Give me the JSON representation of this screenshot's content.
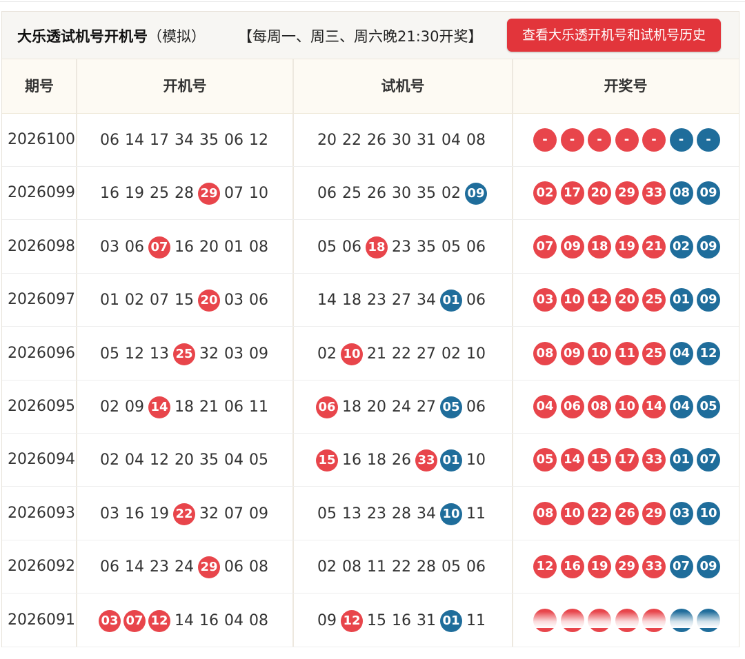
{
  "header": {
    "title": "大乐透试机号开机号",
    "title_suffix": "（模拟）",
    "schedule": "【每周一、周三、周六晚21:30开奖】",
    "history_button": "查看大乐透开机号和试机号历史"
  },
  "columns": [
    "期号",
    "开机号",
    "试机号",
    "开奖号"
  ],
  "colors": {
    "red": "#e8454b",
    "blue": "#1f6d9b",
    "button": "#e2353b"
  },
  "rows": [
    {
      "period": "2026100",
      "kaiji": [
        {
          "v": "06"
        },
        {
          "v": "14"
        },
        {
          "v": "17"
        },
        {
          "v": "34"
        },
        {
          "v": "35"
        },
        {
          "v": "06"
        },
        {
          "v": "12"
        }
      ],
      "shiji": [
        {
          "v": "20"
        },
        {
          "v": "22"
        },
        {
          "v": "26"
        },
        {
          "v": "30"
        },
        {
          "v": "31"
        },
        {
          "v": "04"
        },
        {
          "v": "08"
        }
      ],
      "winning": [
        "-",
        "-",
        "-",
        "-",
        "-",
        "-",
        "-"
      ]
    },
    {
      "period": "2026099",
      "kaiji": [
        {
          "v": "16"
        },
        {
          "v": "19"
        },
        {
          "v": "25"
        },
        {
          "v": "28"
        },
        {
          "v": "29",
          "c": "red"
        },
        {
          "v": "07"
        },
        {
          "v": "10"
        }
      ],
      "shiji": [
        {
          "v": "06"
        },
        {
          "v": "25"
        },
        {
          "v": "26"
        },
        {
          "v": "30"
        },
        {
          "v": "35"
        },
        {
          "v": "02"
        },
        {
          "v": "09",
          "c": "blue"
        }
      ],
      "winning": [
        "02",
        "17",
        "20",
        "29",
        "33",
        "08",
        "09"
      ]
    },
    {
      "period": "2026098",
      "kaiji": [
        {
          "v": "03"
        },
        {
          "v": "06"
        },
        {
          "v": "07",
          "c": "red"
        },
        {
          "v": "16"
        },
        {
          "v": "20"
        },
        {
          "v": "01"
        },
        {
          "v": "08"
        }
      ],
      "shiji": [
        {
          "v": "05"
        },
        {
          "v": "06"
        },
        {
          "v": "18",
          "c": "red"
        },
        {
          "v": "23"
        },
        {
          "v": "35"
        },
        {
          "v": "05"
        },
        {
          "v": "06"
        }
      ],
      "winning": [
        "07",
        "09",
        "18",
        "19",
        "21",
        "02",
        "09"
      ]
    },
    {
      "period": "2026097",
      "kaiji": [
        {
          "v": "01"
        },
        {
          "v": "02"
        },
        {
          "v": "07"
        },
        {
          "v": "15"
        },
        {
          "v": "20",
          "c": "red"
        },
        {
          "v": "03"
        },
        {
          "v": "06"
        }
      ],
      "shiji": [
        {
          "v": "14"
        },
        {
          "v": "18"
        },
        {
          "v": "23"
        },
        {
          "v": "27"
        },
        {
          "v": "34"
        },
        {
          "v": "01",
          "c": "blue"
        },
        {
          "v": "06"
        }
      ],
      "winning": [
        "03",
        "10",
        "12",
        "20",
        "25",
        "01",
        "09"
      ]
    },
    {
      "period": "2026096",
      "kaiji": [
        {
          "v": "05"
        },
        {
          "v": "12"
        },
        {
          "v": "13"
        },
        {
          "v": "25",
          "c": "red"
        },
        {
          "v": "32"
        },
        {
          "v": "03"
        },
        {
          "v": "09"
        }
      ],
      "shiji": [
        {
          "v": "02"
        },
        {
          "v": "10",
          "c": "red"
        },
        {
          "v": "21"
        },
        {
          "v": "22"
        },
        {
          "v": "27"
        },
        {
          "v": "02"
        },
        {
          "v": "10"
        }
      ],
      "winning": [
        "08",
        "09",
        "10",
        "11",
        "25",
        "04",
        "12"
      ]
    },
    {
      "period": "2026095",
      "kaiji": [
        {
          "v": "02"
        },
        {
          "v": "09"
        },
        {
          "v": "14",
          "c": "red"
        },
        {
          "v": "18"
        },
        {
          "v": "21"
        },
        {
          "v": "06"
        },
        {
          "v": "11"
        }
      ],
      "shiji": [
        {
          "v": "06",
          "c": "red"
        },
        {
          "v": "18"
        },
        {
          "v": "20"
        },
        {
          "v": "24"
        },
        {
          "v": "27"
        },
        {
          "v": "05",
          "c": "blue"
        },
        {
          "v": "06"
        }
      ],
      "winning": [
        "04",
        "06",
        "08",
        "10",
        "14",
        "04",
        "05"
      ]
    },
    {
      "period": "2026094",
      "kaiji": [
        {
          "v": "02"
        },
        {
          "v": "04"
        },
        {
          "v": "12"
        },
        {
          "v": "20"
        },
        {
          "v": "35"
        },
        {
          "v": "04"
        },
        {
          "v": "05"
        }
      ],
      "shiji": [
        {
          "v": "15",
          "c": "red"
        },
        {
          "v": "16"
        },
        {
          "v": "18"
        },
        {
          "v": "26"
        },
        {
          "v": "33",
          "c": "red"
        },
        {
          "v": "01",
          "c": "blue"
        },
        {
          "v": "10"
        }
      ],
      "winning": [
        "05",
        "14",
        "15",
        "17",
        "33",
        "01",
        "07"
      ]
    },
    {
      "period": "2026093",
      "kaiji": [
        {
          "v": "03"
        },
        {
          "v": "16"
        },
        {
          "v": "19"
        },
        {
          "v": "22",
          "c": "red"
        },
        {
          "v": "32"
        },
        {
          "v": "07"
        },
        {
          "v": "09"
        }
      ],
      "shiji": [
        {
          "v": "05"
        },
        {
          "v": "13"
        },
        {
          "v": "23"
        },
        {
          "v": "28"
        },
        {
          "v": "34"
        },
        {
          "v": "10",
          "c": "blue"
        },
        {
          "v": "11"
        }
      ],
      "winning": [
        "08",
        "10",
        "22",
        "26",
        "29",
        "03",
        "10"
      ]
    },
    {
      "period": "2026092",
      "kaiji": [
        {
          "v": "06"
        },
        {
          "v": "14"
        },
        {
          "v": "23"
        },
        {
          "v": "24"
        },
        {
          "v": "29",
          "c": "red"
        },
        {
          "v": "06"
        },
        {
          "v": "08"
        }
      ],
      "shiji": [
        {
          "v": "02"
        },
        {
          "v": "08"
        },
        {
          "v": "11"
        },
        {
          "v": "22"
        },
        {
          "v": "28"
        },
        {
          "v": "05"
        },
        {
          "v": "06"
        }
      ],
      "winning": [
        "12",
        "16",
        "19",
        "29",
        "33",
        "07",
        "09"
      ]
    },
    {
      "period": "2026091",
      "kaiji": [
        {
          "v": "03",
          "c": "red"
        },
        {
          "v": "07",
          "c": "red"
        },
        {
          "v": "12",
          "c": "red"
        },
        {
          "v": "14"
        },
        {
          "v": "16"
        },
        {
          "v": "04"
        },
        {
          "v": "08"
        }
      ],
      "shiji": [
        {
          "v": "09"
        },
        {
          "v": "12",
          "c": "red"
        },
        {
          "v": "15"
        },
        {
          "v": "16"
        },
        {
          "v": "31"
        },
        {
          "v": "01",
          "c": "blue"
        },
        {
          "v": "11"
        }
      ],
      "winning": [
        "",
        "",
        "",
        "",
        "",
        "",
        ""
      ]
    }
  ]
}
